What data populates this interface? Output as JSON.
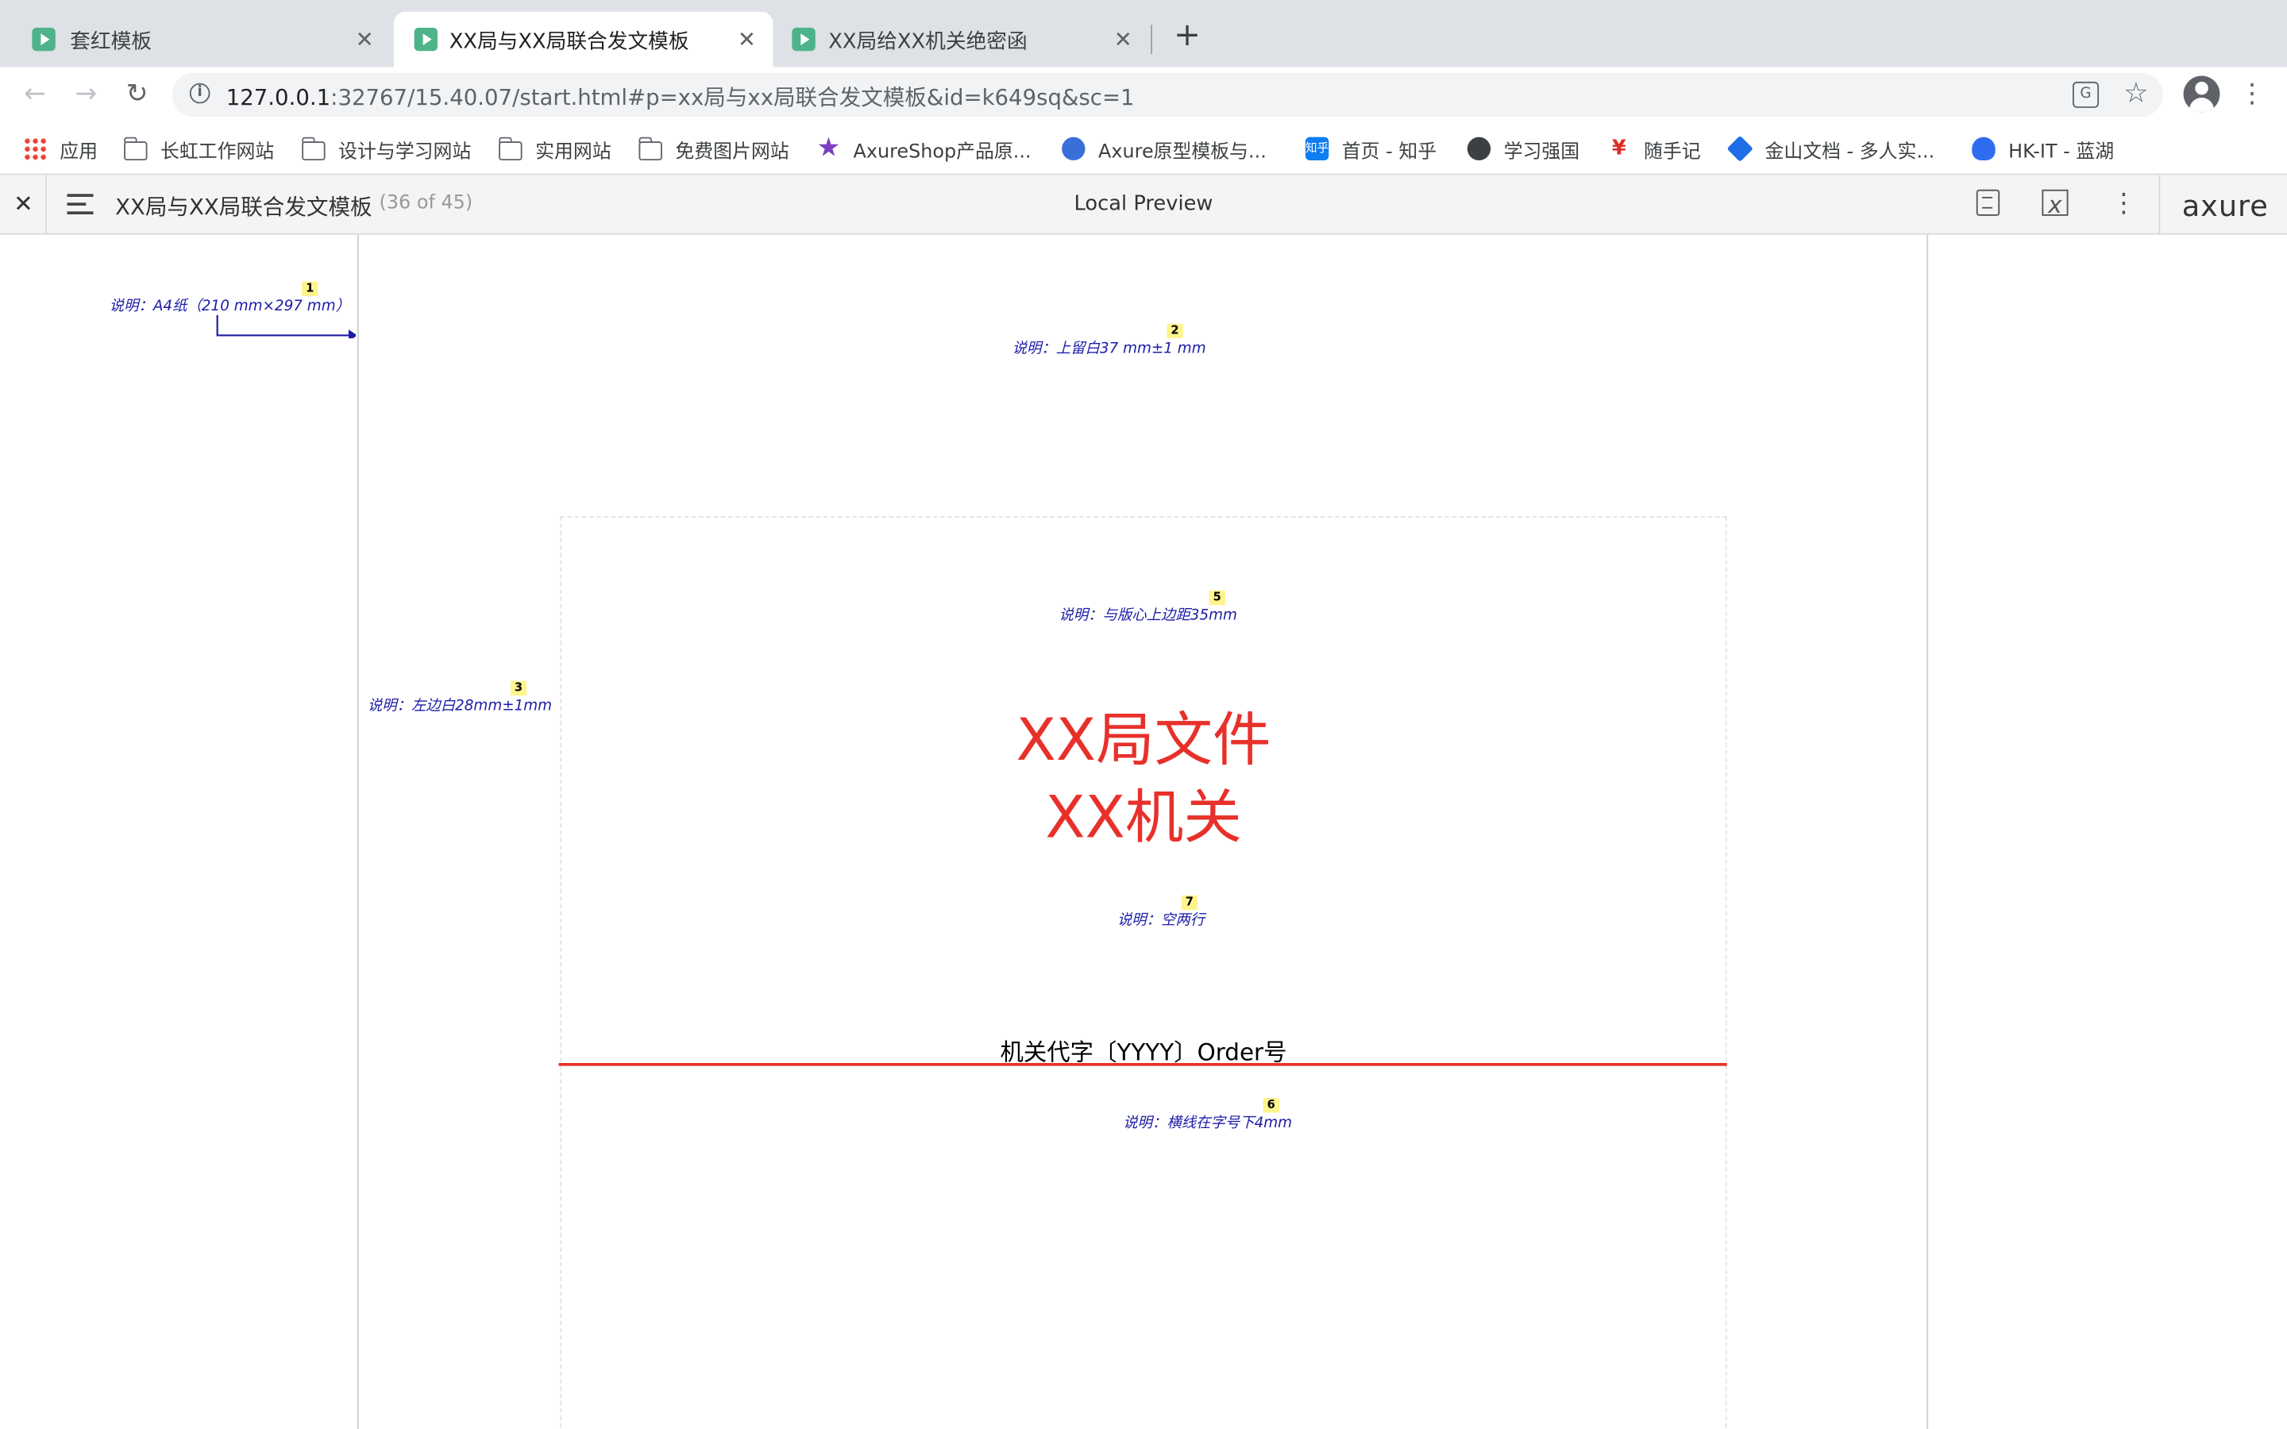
{
  "browser": {
    "tabs": [
      {
        "title": "套红模板",
        "active": false
      },
      {
        "title": "XX局与XX局联合发文模板",
        "active": true
      },
      {
        "title": "XX局给XX机关绝密函",
        "active": false
      }
    ],
    "url_host": "127.0.0.1",
    "url_rest": ":32767/15.40.07/start.html#p=xx局与xx局联合发文模板&id=k649sq&sc=1",
    "bookmarks": [
      {
        "label": "应用",
        "icon": "apps-icon"
      },
      {
        "label": "长虹工作网站",
        "icon": "folder-icon"
      },
      {
        "label": "设计与学习网站",
        "icon": "folder-icon"
      },
      {
        "label": "实用网站",
        "icon": "folder-icon"
      },
      {
        "label": "免费图片网站",
        "icon": "folder-icon"
      },
      {
        "label": "AxureShop产品原...",
        "icon": "axureshop-icon"
      },
      {
        "label": "Axure原型模板与...",
        "icon": "axure-icon"
      },
      {
        "label": "首页 - 知乎",
        "icon": "zhihu-icon"
      },
      {
        "label": "学习强国",
        "icon": "globe-icon"
      },
      {
        "label": "随手记",
        "icon": "yen-icon"
      },
      {
        "label": "金山文档 - 多人实...",
        "icon": "kdocs-icon"
      },
      {
        "label": "HK-IT - 蓝湖",
        "icon": "lanhu-icon"
      }
    ]
  },
  "axure": {
    "page_title": "XX局与XX局联合发文模板",
    "page_count": "(36 of 45)",
    "center_label": "Local Preview",
    "logo": "axure"
  },
  "canvas": {
    "notes": [
      {
        "text": "说明：A4纸（210 mm×297 mm）",
        "num": "1"
      },
      {
        "text": "说明：上留白37 mm±1 mm",
        "num": "2"
      },
      {
        "text": "说明：左边白28mm±1mm",
        "num": "3"
      },
      {
        "text": "说明：与版心上边距35mm",
        "num": "5"
      },
      {
        "text": "说明：空两行",
        "num": "7"
      },
      {
        "text": "说明：横线在字号下4mm",
        "num": "6"
      }
    ],
    "title_line1": "XX局文件",
    "title_line2": "XX机关",
    "doc_number": "机关代字〔YYYY〕Order号"
  },
  "colors": {
    "red": "#e8302a",
    "note_blue": "#1c1ca8",
    "footnote_yellow": "#fff48c",
    "tab_strip": "#dee1e6"
  }
}
